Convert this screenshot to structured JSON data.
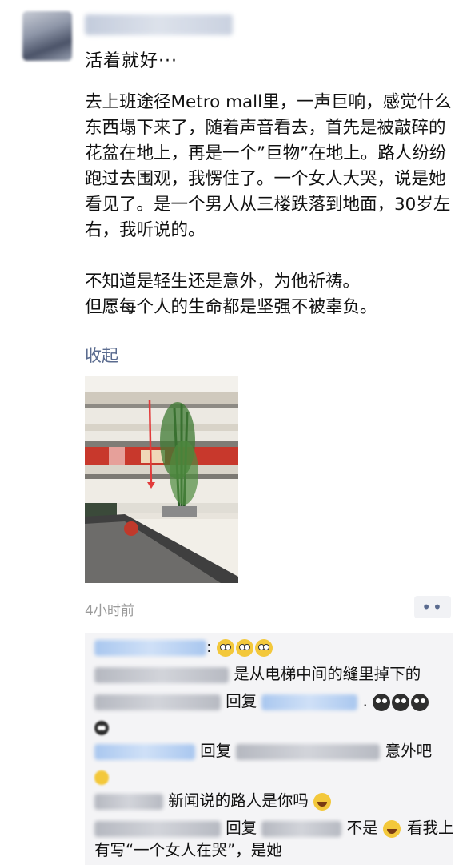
{
  "post": {
    "title": "活着就好···",
    "paragraphs": [
      "去上班途径Metro mall里，一声巨响，感觉什么东西塌下来了，随着声音看去，首先是被敲碎的花盆在地上，再是一个”巨物”在地上。路人纷纷跑过去围观，我愣住了。一个女人大哭，说是她看见了。是一个男人从三楼跌落到地面，30岁左右，我听说的。",
      "不知道是轻生还是意外，为他祈祷。\n但愿每个人的生命都是坚强不被辜负。"
    ],
    "collapse_label": "收起",
    "timestamp": "4小时前",
    "more_label": "••"
  },
  "comments": [
    {
      "text": "是从电梯中间的缝里掉下的"
    },
    {
      "reply_word": "回复",
      "text": "."
    },
    {
      "reply_word": "回复",
      "text": "意外吧"
    },
    {
      "text": "新闻说的路人是你吗"
    },
    {
      "reply_word": "回复",
      "text": "不是",
      "text2": "看我上"
    },
    {
      "text": "有写“一个女人在哭”，是她"
    }
  ],
  "colors": {
    "link": "#5a6b8f",
    "timestamp": "#9a9a9a",
    "comment_bg": "#f4f4f6"
  }
}
